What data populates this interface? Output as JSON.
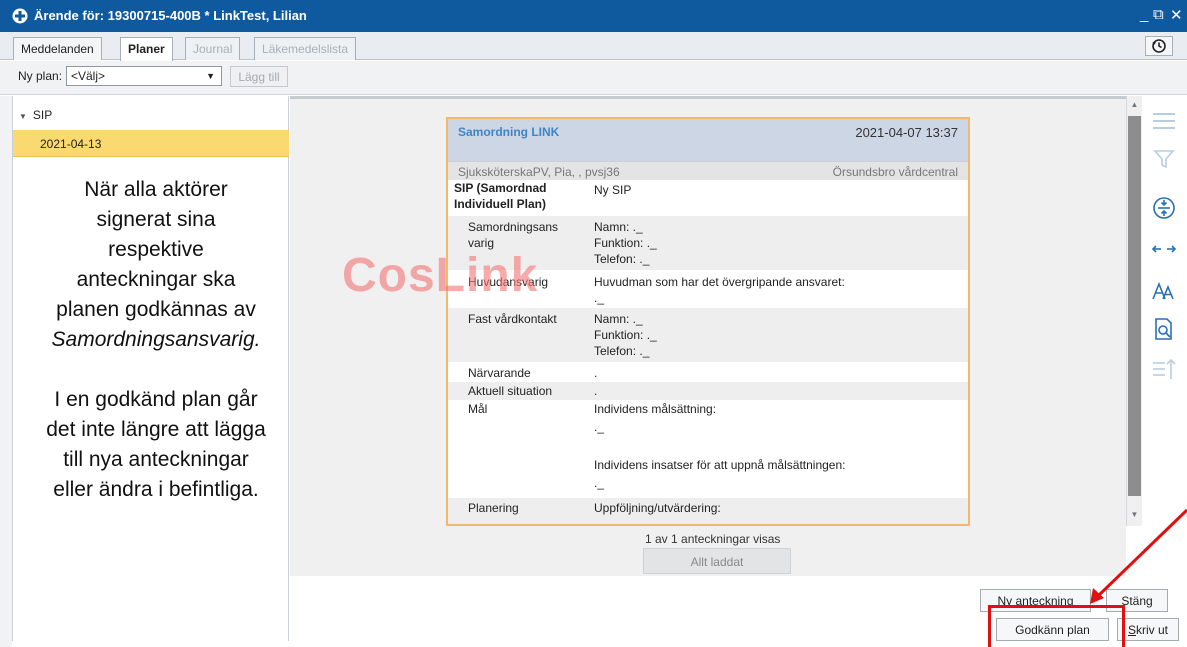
{
  "window": {
    "title": "Ärende för: 19300715-400B * LinkTest, Lilian",
    "minimize": "_",
    "restore": "⧉",
    "close": "✕"
  },
  "tabs": [
    {
      "label": "Meddelanden",
      "state": "normal"
    },
    {
      "label": "Planer",
      "state": "active"
    },
    {
      "label": "Journal",
      "state": "disabled"
    },
    {
      "label": "Läkemedelslista",
      "state": "disabled"
    }
  ],
  "toolbar": {
    "new_plan_label": "Ny plan:",
    "select_value": "<Välj>",
    "add_button": "Lägg till"
  },
  "tree": {
    "group": "SIP",
    "selected_date": "2021-04-13"
  },
  "annotation": {
    "para1_lines": [
      "När alla aktörer",
      "signerat sina",
      "respektive",
      "anteckningar ska",
      "planen godkännas av"
    ],
    "para1_italic": "Samordningsansvarig.",
    "para2_lines": [
      "I en godkänd plan går",
      "det inte längre att lägga",
      "till nya anteckningar",
      "eller ändra i befintliga."
    ]
  },
  "note": {
    "title": "Samordning LINK",
    "timestamp": "2021-04-07 13:37",
    "author": "SjuksköterskaPV, Pia, , pvsj36",
    "place": "Örsundsbro vårdcentral",
    "sip_key_line1": "SIP (Samordnad",
    "sip_key_line2": "Individuell Plan)",
    "sip_value": "Ny SIP",
    "samord_key_line1": "Samordningsans",
    "samord_key_line2": "varig",
    "namn": "Namn:   ._",
    "funktion": "Funktion: ._",
    "telefon": "Telefon:  ._",
    "huvud_key": "Huvudansvarig",
    "huvud_value": "Huvudman som har det övergripande ansvaret:",
    "huvud_value2": "._",
    "fast_key": "Fast vårdkontakt",
    "narvarande_key": "Närvarande",
    "narvarande_value": ".",
    "aktuell_key": "Aktuell situation",
    "aktuell_value": ".",
    "mal_key": "Mål",
    "mal_v1": "Individens målsättning:",
    "mal_v2": "._",
    "mal_v3": "Individens insatser för att uppnå målsättningen:",
    "mal_v4": "._",
    "planering_key": "Planering",
    "planering_value": "Uppföljning/utvärdering:"
  },
  "watermark": "CosLink",
  "list_status": "1 av 1 anteckningar visas",
  "all_loaded": "Allt laddat",
  "buttons": {
    "new_note": "Ny anteckning",
    "close": "Stäng",
    "approve": "Godkänn plan",
    "print_prefix": "S",
    "print_rest": "kriv ut"
  },
  "colors": {
    "titlebar": "#0f5a9e",
    "selected_row": "#fbd971",
    "note_border": "#f3b86a",
    "note_title": "#3d86c6",
    "highlight": "#e01010"
  }
}
